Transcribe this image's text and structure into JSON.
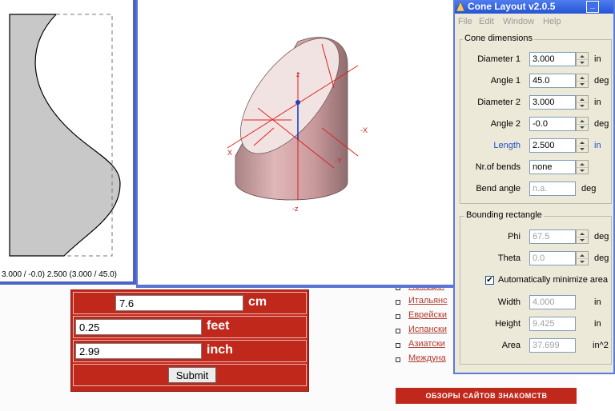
{
  "web_form": {
    "rows": [
      {
        "value": "7.6",
        "unit": "cm"
      },
      {
        "value": "0.25",
        "unit": "feet"
      },
      {
        "value": "2.99",
        "unit": "inch"
      }
    ],
    "submit_label": "Submit"
  },
  "web_links": [
    "Немецки",
    "Итальянс",
    "Еврейски",
    "Испански",
    "Азиатски",
    "Междуна"
  ],
  "reviews_bar": "ОБЗОРЫ САЙТОВ ЗНАКОМСТВ",
  "profile_view": {
    "caption": "3.000 / -0.0) 2.500 (3.000 / 45.0)"
  },
  "view3d": {
    "axis_labels": {
      "z_top": "z",
      "z_bottom": "-z",
      "x_neg": "-X",
      "x": "X",
      "y_neg": "-Y"
    },
    "colors": {
      "cone": "#cfa1a3",
      "axes": "#e02020",
      "z_axis": "#1f3fbf"
    }
  },
  "dialog": {
    "title": "Cone Layout v2.0.5",
    "minimize_label": "_",
    "menu": [
      "File",
      "Edit",
      "Window",
      "Help"
    ],
    "cone_dimensions": {
      "title": "Cone dimensions",
      "fields": [
        {
          "label": "Diameter 1",
          "value": "3.000",
          "unit": "in"
        },
        {
          "label": "Angle 1",
          "value": "45.0",
          "unit": "deg"
        },
        {
          "label": "Diameter 2",
          "value": "3.000",
          "unit": "in"
        },
        {
          "label": "Angle 2",
          "value": "-0.0",
          "unit": "deg"
        },
        {
          "label": "Length",
          "value": "2.500",
          "unit": "in"
        },
        {
          "label": "Nr.of bends",
          "value": "none",
          "unit": ""
        },
        {
          "label": "Bend angle",
          "value": "n.a.",
          "unit": "deg"
        }
      ]
    },
    "bounding_rectangle": {
      "title": "Bounding rectangle",
      "phi": {
        "label": "Phi",
        "value": "67.5",
        "unit": "deg"
      },
      "theta": {
        "label": "Theta",
        "value": "0.0",
        "unit": "deg"
      },
      "auto_minimize": {
        "label": "Automatically minimize area",
        "checked": true,
        "mark": "✔"
      },
      "width": {
        "label": "Width",
        "value": "4.000",
        "unit": "in"
      },
      "height": {
        "label": "Height",
        "value": "9.425",
        "unit": "in"
      },
      "area": {
        "label": "Area",
        "value": "37.699",
        "unit": "in^2"
      }
    }
  }
}
